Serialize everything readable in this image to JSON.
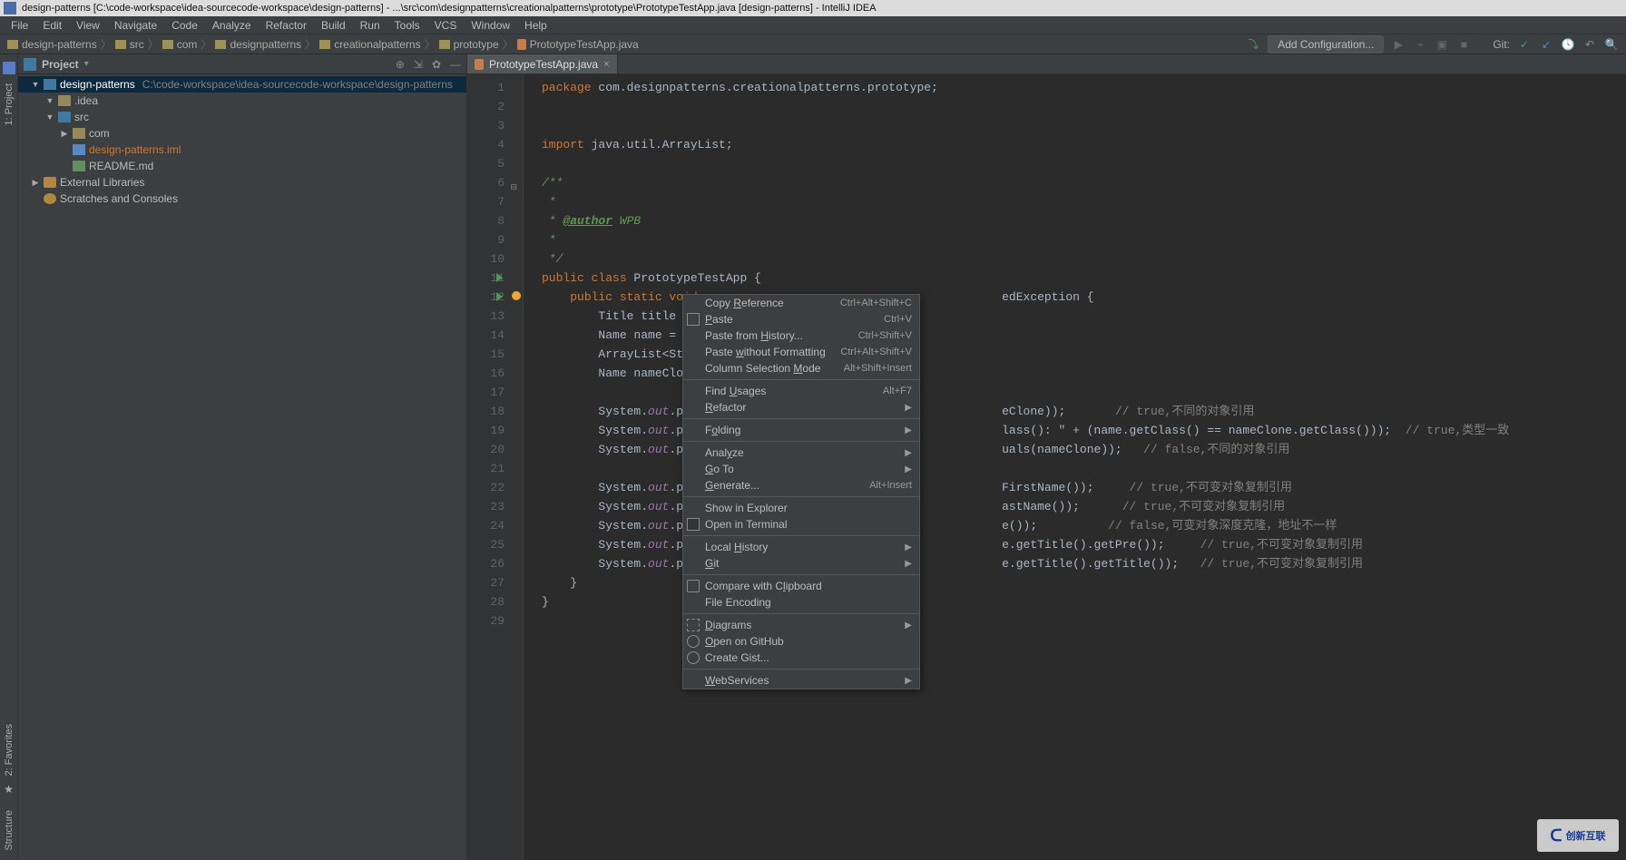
{
  "title": "design-patterns [C:\\code-workspace\\idea-sourcecode-workspace\\design-patterns] - ...\\src\\com\\designpatterns\\creationalpatterns\\prototype\\PrototypeTestApp.java [design-patterns] - IntelliJ IDEA",
  "menu": [
    "File",
    "Edit",
    "View",
    "Navigate",
    "Code",
    "Analyze",
    "Refactor",
    "Build",
    "Run",
    "Tools",
    "VCS",
    "Window",
    "Help"
  ],
  "breadcrumbs": [
    "design-patterns",
    "src",
    "com",
    "designpatterns",
    "creationalpatterns",
    "prototype",
    "PrototypeTestApp.java"
  ],
  "nav_right": {
    "add_config": "Add Configuration...",
    "git_label": "Git:"
  },
  "project_header": {
    "label": "Project"
  },
  "tree": [
    {
      "depth": 0,
      "exp": "▼",
      "icon": "folder-blue",
      "label": "design-patterns",
      "suffix": "C:\\code-workspace\\idea-sourcecode-workspace\\design-patterns",
      "sel": true
    },
    {
      "depth": 1,
      "exp": "▼",
      "icon": "folder",
      "label": ".idea"
    },
    {
      "depth": 1,
      "exp": "▼",
      "icon": "folder-blue",
      "label": "src"
    },
    {
      "depth": 2,
      "exp": "▶",
      "icon": "folder",
      "label": "com"
    },
    {
      "depth": 2,
      "exp": "",
      "icon": "iml",
      "label": "design-patterns.iml",
      "cls": "highlight"
    },
    {
      "depth": 2,
      "exp": "",
      "icon": "md",
      "label": "README.md"
    },
    {
      "depth": 0,
      "exp": "▶",
      "icon": "lib",
      "label": "External Libraries"
    },
    {
      "depth": 0,
      "exp": "",
      "icon": "scratch",
      "label": "Scratches and Consoles"
    }
  ],
  "tabs": [
    {
      "label": "PrototypeTestApp.java"
    }
  ],
  "code": {
    "l1": "package com.designpatterns.creationalpatterns.prototype;",
    "l2": "",
    "l3": "",
    "l4": "import java.util.ArrayList;",
    "l5": "",
    "l6": "/**",
    "l7": " *",
    "l8": " * @author WPB",
    "l9": " *",
    "l10": " */",
    "l11": "public class PrototypeTestApp {",
    "l12": "    public static void main(String[] args) throws CloneNotSupportedException {",
    "l13": "        Title title = new ",
    "l14": "        Name name = new N",
    "l15": "        ArrayList<String>",
    "l16": "        Name nameClone = ",
    "l17": "",
    "l18a": "        System.out.printl",
    "l18b": "eClone));       // true,不同的对象引用",
    "l19a": "        System.out.printl",
    "l19b": "lass(): \" + (name.getClass() == nameClone.getClass()));  // true,类型一致",
    "l20a": "        System.out.printl",
    "l20b": "uals(nameClone));   // false,不同的对象引用",
    "l21": "",
    "l22a": "        System.out.printl",
    "l22b": "FirstName());     // true,不可变对象复制引用",
    "l23a": "        System.out.printl",
    "l23b": "astName());      // true,不可变对象复制引用",
    "l24a": "        System.out.printl",
    "l24b": "e());          // false,可变对象深度克隆，地址不一样",
    "l25a": "        System.out.printl",
    "l25b": "e.getTitle().getPre());     // true,不可变对象复制引用",
    "l26a": "        System.out.printl",
    "l26b": "e.getTitle().getTitle());   // true,不可变对象复制引用",
    "l27": "    }",
    "l28": "}",
    "l29": ""
  },
  "ctx_menu": [
    {
      "type": "item",
      "label": "Copy Reference",
      "shortcut": "Ctrl+Alt+Shift+C",
      "u": [
        5
      ]
    },
    {
      "type": "item",
      "label": "Paste",
      "shortcut": "Ctrl+V",
      "icon": "paste",
      "u": [
        0
      ]
    },
    {
      "type": "item",
      "label": "Paste from History...",
      "shortcut": "Ctrl+Shift+V",
      "u": [
        11
      ]
    },
    {
      "type": "item",
      "label": "Paste without Formatting",
      "shortcut": "Ctrl+Alt+Shift+V",
      "u": [
        6
      ]
    },
    {
      "type": "item",
      "label": "Column Selection Mode",
      "shortcut": "Alt+Shift+Insert",
      "u": [
        17
      ]
    },
    {
      "type": "sep"
    },
    {
      "type": "item",
      "label": "Find Usages",
      "shortcut": "Alt+F7",
      "u": [
        5
      ]
    },
    {
      "type": "item",
      "label": "Refactor",
      "sub": true,
      "u": [
        0
      ]
    },
    {
      "type": "sep"
    },
    {
      "type": "item",
      "label": "Folding",
      "sub": true,
      "u": [
        1
      ]
    },
    {
      "type": "sep"
    },
    {
      "type": "item",
      "label": "Analyze",
      "sub": true,
      "u": [
        4
      ]
    },
    {
      "type": "item",
      "label": "Go To",
      "sub": true,
      "u": [
        0
      ]
    },
    {
      "type": "item",
      "label": "Generate...",
      "shortcut": "Alt+Insert",
      "u": [
        0
      ]
    },
    {
      "type": "sep"
    },
    {
      "type": "item",
      "label": "Show in Explorer"
    },
    {
      "type": "item",
      "label": "Open in Terminal",
      "icon": "terminal"
    },
    {
      "type": "sep"
    },
    {
      "type": "item",
      "label": "Local History",
      "sub": true,
      "u": [
        6
      ]
    },
    {
      "type": "item",
      "label": "Git",
      "sub": true,
      "u": [
        0
      ]
    },
    {
      "type": "sep"
    },
    {
      "type": "item",
      "label": "Compare with Clipboard",
      "icon": "clip",
      "u": [
        14
      ]
    },
    {
      "type": "item",
      "label": "File Encoding"
    },
    {
      "type": "sep"
    },
    {
      "type": "item",
      "label": "Diagrams",
      "sub": true,
      "icon": "diag",
      "u": [
        0
      ]
    },
    {
      "type": "item",
      "label": "Open on GitHub",
      "icon": "gh",
      "u": [
        0
      ]
    },
    {
      "type": "item",
      "label": "Create Gist...",
      "icon": "gh"
    },
    {
      "type": "sep"
    },
    {
      "type": "item",
      "label": "WebServices",
      "sub": true,
      "u": [
        0
      ]
    }
  ],
  "tool_strip": {
    "project": "1: Project",
    "favorites": "2: Favorites",
    "structure": "Structure"
  },
  "watermark": "创新互联"
}
